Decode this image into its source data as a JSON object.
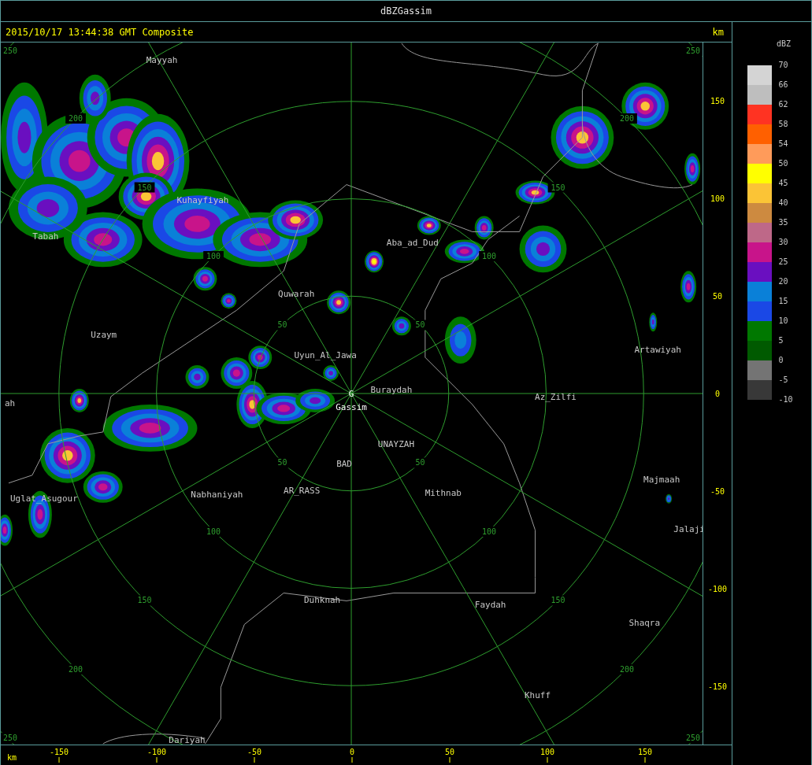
{
  "window": {
    "title": "dBZGassim"
  },
  "header": {
    "timestamp": "2015/10/17 13:44:38 GMT Composite",
    "unit": "km"
  },
  "map": {
    "center_marker": "G",
    "range_rings": [
      {
        "labels": [
          "50",
          "50",
          "50",
          "50"
        ]
      },
      {
        "labels": [
          "100",
          "100",
          "100",
          "100"
        ]
      },
      {
        "labels": [
          "150",
          "150",
          "150",
          "150"
        ]
      },
      {
        "labels": [
          "200",
          "200",
          "200",
          "200"
        ]
      },
      {
        "labels": [
          "250",
          "250",
          "250",
          "250"
        ]
      }
    ],
    "cities": [
      {
        "name": "Mayyah"
      },
      {
        "name": "Kuhayfiyah"
      },
      {
        "name": "Tabah"
      },
      {
        "name": "Aba_ad_Dud"
      },
      {
        "name": "Quwarah"
      },
      {
        "name": "Uzaym"
      },
      {
        "name": "Artawiyah"
      },
      {
        "name": "Uyun_Al_Jawa"
      },
      {
        "name": "Buraydah"
      },
      {
        "name": "ah"
      },
      {
        "name": "Az_Zilfi"
      },
      {
        "name": "Gassim"
      },
      {
        "name": "UNAYZAH"
      },
      {
        "name": "BAD"
      },
      {
        "name": "Majmaah"
      },
      {
        "name": "AR_RASS"
      },
      {
        "name": "Nabhaniyah"
      },
      {
        "name": "Mithnab"
      },
      {
        "name": "Uglat_Asugour"
      },
      {
        "name": "Jalaji"
      },
      {
        "name": "Duhknah"
      },
      {
        "name": "Faydah"
      },
      {
        "name": "Shaqra"
      },
      {
        "name": "Khuff"
      },
      {
        "name": "Dariyah"
      }
    ]
  },
  "y_axis": {
    "ticks": [
      "150",
      "100",
      "50",
      "0",
      "-50",
      "-100",
      "-150"
    ]
  },
  "x_axis": {
    "unit": "km",
    "ticks": [
      "-150",
      "-100",
      "-50",
      "0",
      "50",
      "100",
      "150"
    ]
  },
  "legend": {
    "title": "dBZ",
    "top_label": "70",
    "bands": [
      {
        "color": "#d4d4d4",
        "label": "66"
      },
      {
        "color": "#bebebe",
        "label": "62"
      },
      {
        "color": "#ff3322",
        "label": "58"
      },
      {
        "color": "#ff6000",
        "label": "54"
      },
      {
        "color": "#ff9b5a",
        "label": "50"
      },
      {
        "color": "#ffff00",
        "label": "45"
      },
      {
        "color": "#fbc436",
        "label": "40"
      },
      {
        "color": "#cd8a40",
        "label": "35"
      },
      {
        "color": "#be6888",
        "label": "30"
      },
      {
        "color": "#c8148a",
        "label": "25"
      },
      {
        "color": "#6a0fc0",
        "label": "20"
      },
      {
        "color": "#0a80d8",
        "label": "15"
      },
      {
        "color": "#1a48e6",
        "label": "10"
      },
      {
        "color": "#007800",
        "label": "5"
      },
      {
        "color": "#005a00",
        "label": "0"
      },
      {
        "color": "#747474",
        "label": "-5"
      },
      {
        "color": "#383838",
        "label": "-10"
      }
    ]
  }
}
